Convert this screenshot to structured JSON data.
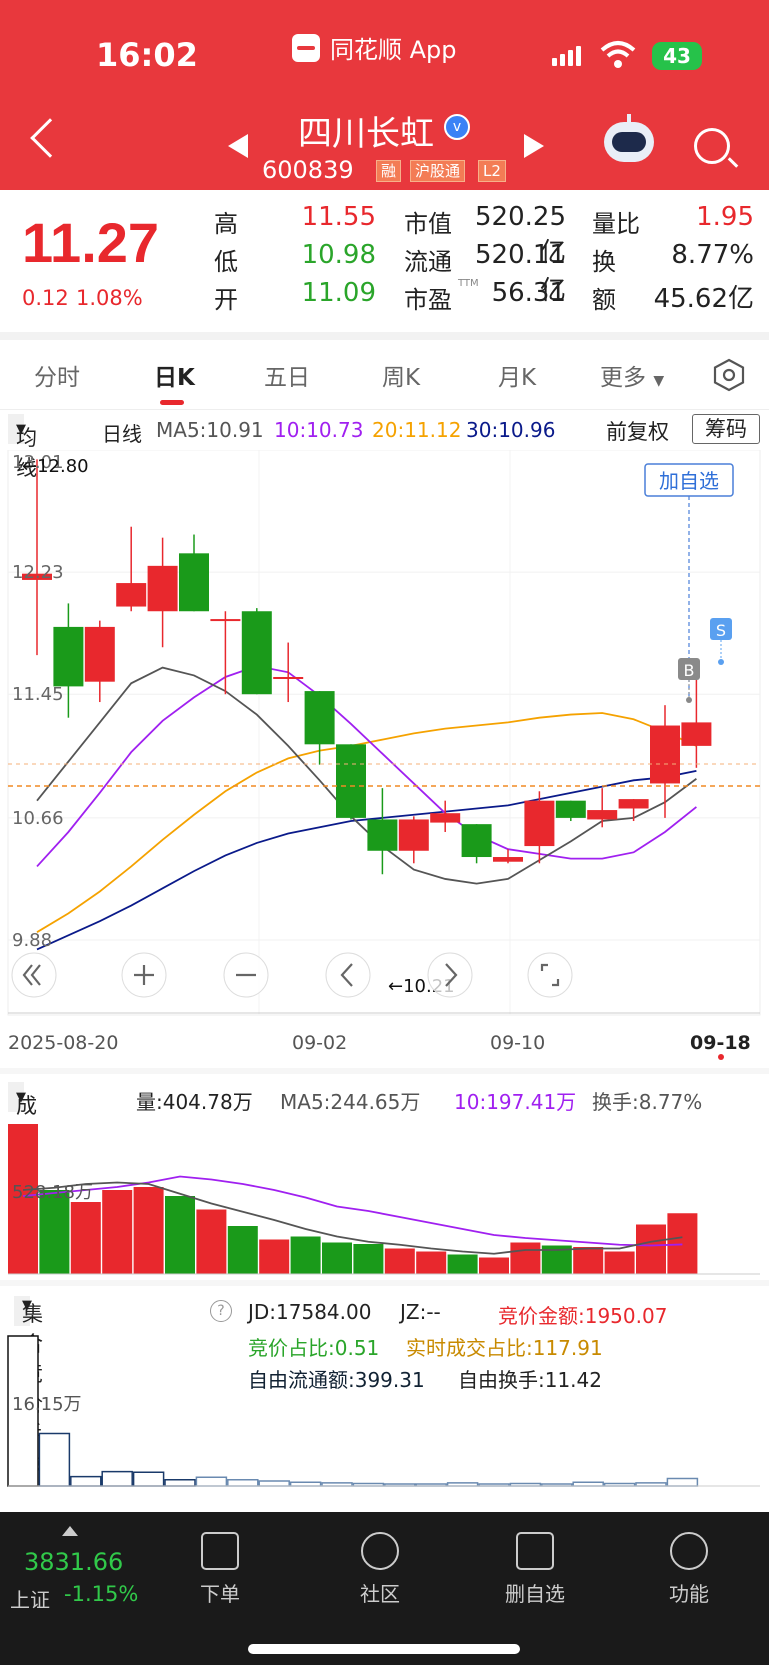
{
  "status_bar": {
    "time": "16:02",
    "app": "同花顺 App",
    "battery": "43"
  },
  "header": {
    "stock_name": "四川长虹",
    "verified_mark": "v",
    "stock_code": "600839",
    "tags": [
      "融",
      "沪股通",
      "L2"
    ]
  },
  "quote": {
    "price": "11.27",
    "change": "0.12",
    "change_pct": "1.08%",
    "rows": [
      [
        {
          "label": "高",
          "value": "11.55"
        },
        {
          "label": "市值",
          "value": "520.25亿"
        },
        {
          "label": "量比",
          "value": "1.95"
        }
      ],
      [
        {
          "label": "低",
          "value": "10.98"
        },
        {
          "label": "流通",
          "value": "520.11亿"
        },
        {
          "label": "换",
          "value": "8.77%"
        }
      ],
      [
        {
          "label": "开",
          "value": "11.09"
        },
        {
          "label": "市盈",
          "sup": "TTM",
          "value": "56.31"
        },
        {
          "label": "额",
          "value": "45.62亿"
        }
      ]
    ]
  },
  "tabs": [
    "分时",
    "日K",
    "五日",
    "周K",
    "月K",
    "更多"
  ],
  "active_tab": "日K",
  "ma_bar": {
    "dropdown": "均线",
    "period": "日线",
    "ma5": "MA5:10.91",
    "ma10": "10:10.73",
    "ma20": "20:11.12",
    "ma30": "30:10.96",
    "adjust": "前复权",
    "chip": "筹码"
  },
  "kline": {
    "y_labels": [
      "13.01",
      "12.23",
      "11.45",
      "10.66",
      "9.88"
    ],
    "max_marker": "←12.80",
    "min_marker": "←10.21",
    "add_watch": "加自选",
    "buy_marker": "B",
    "sell_marker": "S",
    "x_labels": [
      "2025-08-20",
      "09-02",
      "09-10",
      "09-18"
    ],
    "ohlc": [
      [
        12.18,
        12.95,
        11.7,
        12.22
      ],
      [
        11.88,
        12.03,
        11.3,
        11.5
      ],
      [
        11.53,
        11.92,
        11.4,
        11.88
      ],
      [
        12.01,
        12.52,
        11.98,
        12.16
      ],
      [
        11.98,
        12.45,
        11.75,
        12.27
      ],
      [
        12.35,
        12.47,
        11.98,
        11.98
      ],
      [
        11.93,
        11.98,
        11.45,
        11.93
      ],
      [
        11.98,
        12.0,
        11.45,
        11.45
      ],
      [
        11.56,
        11.78,
        11.4,
        11.56
      ],
      [
        11.47,
        11.47,
        11.0,
        11.13
      ],
      [
        11.13,
        11.13,
        10.65,
        10.66
      ],
      [
        10.65,
        10.85,
        10.3,
        10.45
      ],
      [
        10.45,
        10.67,
        10.37,
        10.65
      ],
      [
        10.63,
        10.77,
        10.57,
        10.69
      ],
      [
        10.62,
        10.62,
        10.37,
        10.41
      ],
      [
        10.38,
        10.46,
        10.37,
        10.41
      ],
      [
        10.48,
        10.83,
        10.37,
        10.77
      ],
      [
        10.77,
        10.77,
        10.64,
        10.66
      ],
      [
        10.65,
        10.85,
        10.6,
        10.71
      ],
      [
        10.72,
        10.78,
        10.64,
        10.78
      ],
      [
        10.88,
        11.38,
        10.66,
        11.25
      ],
      [
        11.12,
        11.55,
        10.98,
        11.27
      ]
    ],
    "ma5": [
      10.77,
      11.02,
      11.27,
      11.52,
      11.62,
      11.57,
      11.47,
      11.32,
      11.12,
      10.9,
      10.67,
      10.48,
      10.33,
      10.27,
      10.24,
      10.27,
      10.39,
      10.51,
      10.64,
      10.66,
      10.76,
      10.91
    ],
    "ma10": [
      10.35,
      10.57,
      10.82,
      11.08,
      11.28,
      11.43,
      11.56,
      11.63,
      11.59,
      11.44,
      11.26,
      11.07,
      10.88,
      10.69,
      10.55,
      10.46,
      10.43,
      10.4,
      10.4,
      10.44,
      10.57,
      10.73
    ],
    "ma20": [
      9.93,
      10.05,
      10.19,
      10.35,
      10.52,
      10.68,
      10.83,
      10.95,
      11.04,
      11.09,
      11.12,
      11.16,
      11.2,
      11.23,
      11.25,
      11.27,
      11.3,
      11.32,
      11.33,
      11.29,
      11.21,
      11.12
    ],
    "ma30": [
      9.82,
      9.91,
      10.0,
      10.1,
      10.21,
      10.32,
      10.42,
      10.5,
      10.56,
      10.6,
      10.64,
      10.66,
      10.68,
      10.7,
      10.72,
      10.74,
      10.78,
      10.82,
      10.86,
      10.9,
      10.92,
      10.96
    ]
  },
  "volume": {
    "dropdown": "成交量",
    "vol": "量:404.78万",
    "ma5": "MA5:244.65万",
    "ma10": "10:197.41万",
    "turnover": "换手:8.77%",
    "axis_label": "528.18万",
    "values": [
      1000,
      560,
      480,
      560,
      580,
      520,
      430,
      320,
      230,
      250,
      210,
      200,
      170,
      150,
      130,
      110,
      210,
      190,
      180,
      150,
      330,
      405
    ],
    "ma5_line": [
      560,
      575,
      600,
      610,
      600,
      535,
      470,
      415,
      360,
      300,
      250,
      215,
      195,
      170,
      150,
      135,
      160,
      160,
      170,
      170,
      215,
      245
    ],
    "ma10_line": [
      520,
      540,
      560,
      580,
      610,
      650,
      630,
      600,
      560,
      510,
      450,
      420,
      380,
      340,
      300,
      260,
      240,
      225,
      210,
      195,
      190,
      197
    ]
  },
  "auction": {
    "dropdown": "集合竞价手数",
    "help": "?",
    "jd": "JD:17584.00",
    "jz": "JZ:--",
    "amount": "竞价金额:1950.07",
    "ratio": "竞价占比:0.51",
    "realtime_ratio": "实时成交占比:117.91",
    "free_float": "自由流通额:399.31",
    "free_turnover": "自由换手:11.42",
    "axis_label": "16.15万",
    "values": [
      24.0,
      8.4,
      1.5,
      2.3,
      2.2,
      1.0,
      1.4,
      1.0,
      0.8,
      0.6,
      0.5,
      0.4,
      0.3,
      0.3,
      0.5,
      0.3,
      0.4,
      0.3,
      0.6,
      0.4,
      0.5,
      1.2
    ]
  },
  "bottom_bar": {
    "index_value": "3831.66",
    "index_name": "上证",
    "index_change": "-1.15%",
    "items": [
      "下单",
      "社区",
      "删自选",
      "功能"
    ]
  },
  "colors": {
    "up": "#e8282d",
    "down": "#1a9a1a",
    "ma5": "#555555",
    "ma10": "#a020f0",
    "ma20": "#f5a200",
    "ma30": "#0a1a8a",
    "header": "#e8383d"
  }
}
